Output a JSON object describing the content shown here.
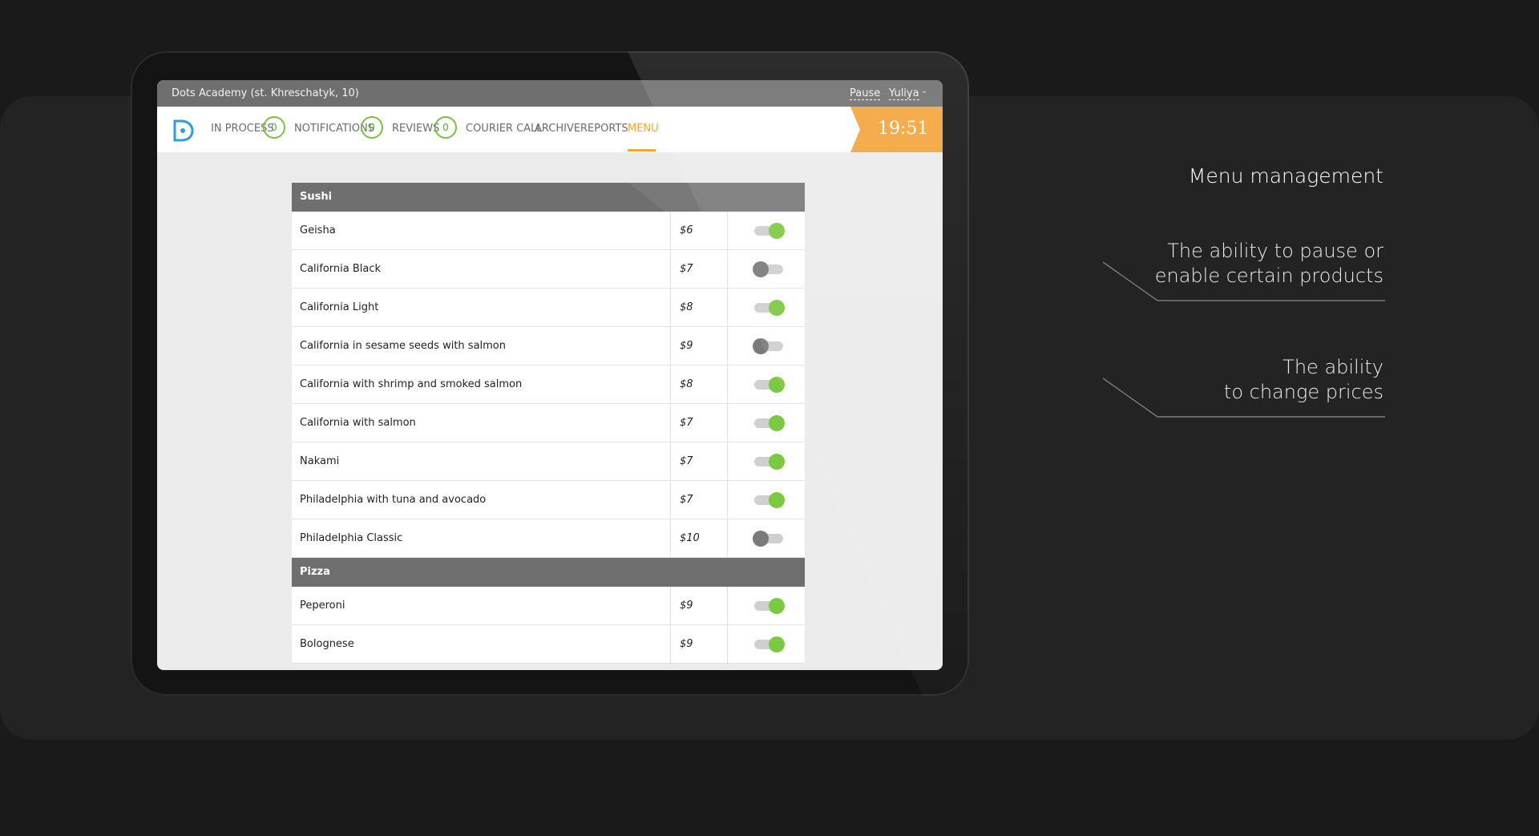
{
  "topbar": {
    "store_name": "Dots Academy (st. Khreschatyk, 10)",
    "pause_label": "Pause",
    "user_name": "Yuliya"
  },
  "nav": {
    "items": [
      {
        "label": "IN PROCESS",
        "count": "0"
      },
      {
        "label": "NOTIFICATIONS",
        "count": "0"
      },
      {
        "label": "REVIEWS",
        "count": "0"
      },
      {
        "label": "COURIER CALL"
      },
      {
        "label": "ARCHIVE"
      },
      {
        "label": "REPORTS"
      },
      {
        "label": "MENU",
        "active": true
      }
    ],
    "clock": "19:51"
  },
  "menu": {
    "categories": [
      {
        "name": "Sushi",
        "items": [
          {
            "name": "Geisha",
            "price": "$6",
            "enabled": true
          },
          {
            "name": "California Black",
            "price": "$7",
            "enabled": false
          },
          {
            "name": "California Light",
            "price": "$8",
            "enabled": true
          },
          {
            "name": "California in sesame seeds with salmon",
            "price": "$9",
            "enabled": false
          },
          {
            "name": "California with shrimp and smoked salmon",
            "price": "$8",
            "enabled": true
          },
          {
            "name": "California with salmon",
            "price": "$7",
            "enabled": true
          },
          {
            "name": "Nakami",
            "price": "$7",
            "enabled": true
          },
          {
            "name": "Philadelphia with tuna and avocado",
            "price": "$7",
            "enabled": true
          },
          {
            "name": "Philadelphia Classic",
            "price": "$10",
            "enabled": false
          }
        ]
      },
      {
        "name": "Pizza",
        "items": [
          {
            "name": "Peperoni",
            "price": "$9",
            "enabled": true
          },
          {
            "name": "Bolognese",
            "price": "$9",
            "enabled": true
          }
        ]
      }
    ]
  },
  "side": {
    "title": "Menu management",
    "feature1_line1": "The ability to pause or",
    "feature1_line2": "enable certain products",
    "feature2_line1": "The ability",
    "feature2_line2": "to change prices"
  },
  "colors": {
    "accent": "#f4a43a",
    "toggle_on": "#7bc940",
    "toggle_off": "#7a7a7a",
    "badge": "#79c143"
  }
}
